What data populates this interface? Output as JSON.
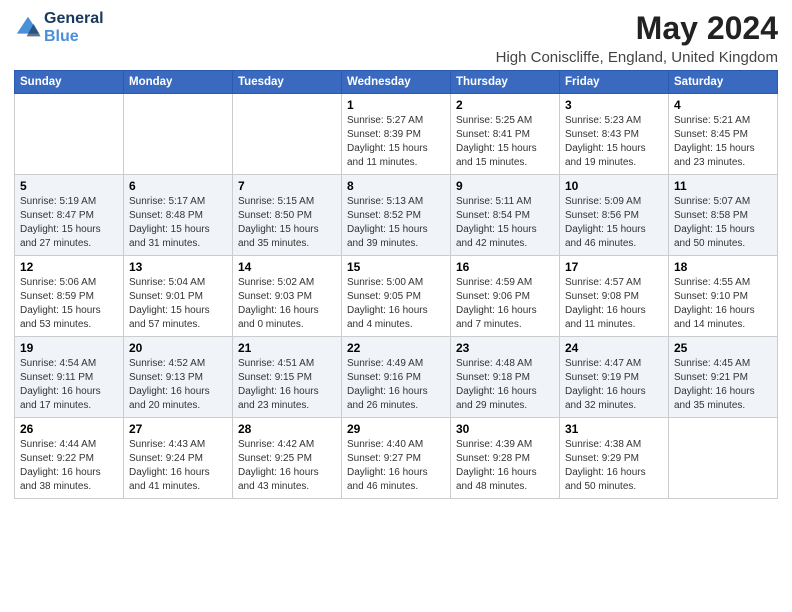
{
  "logo": {
    "line1": "General",
    "line2": "Blue"
  },
  "title": "May 2024",
  "location": "High Coniscliffe, England, United Kingdom",
  "headers": [
    "Sunday",
    "Monday",
    "Tuesday",
    "Wednesday",
    "Thursday",
    "Friday",
    "Saturday"
  ],
  "weeks": [
    [
      {
        "day": "",
        "info": ""
      },
      {
        "day": "",
        "info": ""
      },
      {
        "day": "",
        "info": ""
      },
      {
        "day": "1",
        "info": "Sunrise: 5:27 AM\nSunset: 8:39 PM\nDaylight: 15 hours\nand 11 minutes."
      },
      {
        "day": "2",
        "info": "Sunrise: 5:25 AM\nSunset: 8:41 PM\nDaylight: 15 hours\nand 15 minutes."
      },
      {
        "day": "3",
        "info": "Sunrise: 5:23 AM\nSunset: 8:43 PM\nDaylight: 15 hours\nand 19 minutes."
      },
      {
        "day": "4",
        "info": "Sunrise: 5:21 AM\nSunset: 8:45 PM\nDaylight: 15 hours\nand 23 minutes."
      }
    ],
    [
      {
        "day": "5",
        "info": "Sunrise: 5:19 AM\nSunset: 8:47 PM\nDaylight: 15 hours\nand 27 minutes."
      },
      {
        "day": "6",
        "info": "Sunrise: 5:17 AM\nSunset: 8:48 PM\nDaylight: 15 hours\nand 31 minutes."
      },
      {
        "day": "7",
        "info": "Sunrise: 5:15 AM\nSunset: 8:50 PM\nDaylight: 15 hours\nand 35 minutes."
      },
      {
        "day": "8",
        "info": "Sunrise: 5:13 AM\nSunset: 8:52 PM\nDaylight: 15 hours\nand 39 minutes."
      },
      {
        "day": "9",
        "info": "Sunrise: 5:11 AM\nSunset: 8:54 PM\nDaylight: 15 hours\nand 42 minutes."
      },
      {
        "day": "10",
        "info": "Sunrise: 5:09 AM\nSunset: 8:56 PM\nDaylight: 15 hours\nand 46 minutes."
      },
      {
        "day": "11",
        "info": "Sunrise: 5:07 AM\nSunset: 8:58 PM\nDaylight: 15 hours\nand 50 minutes."
      }
    ],
    [
      {
        "day": "12",
        "info": "Sunrise: 5:06 AM\nSunset: 8:59 PM\nDaylight: 15 hours\nand 53 minutes."
      },
      {
        "day": "13",
        "info": "Sunrise: 5:04 AM\nSunset: 9:01 PM\nDaylight: 15 hours\nand 57 minutes."
      },
      {
        "day": "14",
        "info": "Sunrise: 5:02 AM\nSunset: 9:03 PM\nDaylight: 16 hours\nand 0 minutes."
      },
      {
        "day": "15",
        "info": "Sunrise: 5:00 AM\nSunset: 9:05 PM\nDaylight: 16 hours\nand 4 minutes."
      },
      {
        "day": "16",
        "info": "Sunrise: 4:59 AM\nSunset: 9:06 PM\nDaylight: 16 hours\nand 7 minutes."
      },
      {
        "day": "17",
        "info": "Sunrise: 4:57 AM\nSunset: 9:08 PM\nDaylight: 16 hours\nand 11 minutes."
      },
      {
        "day": "18",
        "info": "Sunrise: 4:55 AM\nSunset: 9:10 PM\nDaylight: 16 hours\nand 14 minutes."
      }
    ],
    [
      {
        "day": "19",
        "info": "Sunrise: 4:54 AM\nSunset: 9:11 PM\nDaylight: 16 hours\nand 17 minutes."
      },
      {
        "day": "20",
        "info": "Sunrise: 4:52 AM\nSunset: 9:13 PM\nDaylight: 16 hours\nand 20 minutes."
      },
      {
        "day": "21",
        "info": "Sunrise: 4:51 AM\nSunset: 9:15 PM\nDaylight: 16 hours\nand 23 minutes."
      },
      {
        "day": "22",
        "info": "Sunrise: 4:49 AM\nSunset: 9:16 PM\nDaylight: 16 hours\nand 26 minutes."
      },
      {
        "day": "23",
        "info": "Sunrise: 4:48 AM\nSunset: 9:18 PM\nDaylight: 16 hours\nand 29 minutes."
      },
      {
        "day": "24",
        "info": "Sunrise: 4:47 AM\nSunset: 9:19 PM\nDaylight: 16 hours\nand 32 minutes."
      },
      {
        "day": "25",
        "info": "Sunrise: 4:45 AM\nSunset: 9:21 PM\nDaylight: 16 hours\nand 35 minutes."
      }
    ],
    [
      {
        "day": "26",
        "info": "Sunrise: 4:44 AM\nSunset: 9:22 PM\nDaylight: 16 hours\nand 38 minutes."
      },
      {
        "day": "27",
        "info": "Sunrise: 4:43 AM\nSunset: 9:24 PM\nDaylight: 16 hours\nand 41 minutes."
      },
      {
        "day": "28",
        "info": "Sunrise: 4:42 AM\nSunset: 9:25 PM\nDaylight: 16 hours\nand 43 minutes."
      },
      {
        "day": "29",
        "info": "Sunrise: 4:40 AM\nSunset: 9:27 PM\nDaylight: 16 hours\nand 46 minutes."
      },
      {
        "day": "30",
        "info": "Sunrise: 4:39 AM\nSunset: 9:28 PM\nDaylight: 16 hours\nand 48 minutes."
      },
      {
        "day": "31",
        "info": "Sunrise: 4:38 AM\nSunset: 9:29 PM\nDaylight: 16 hours\nand 50 minutes."
      },
      {
        "day": "",
        "info": ""
      }
    ]
  ]
}
